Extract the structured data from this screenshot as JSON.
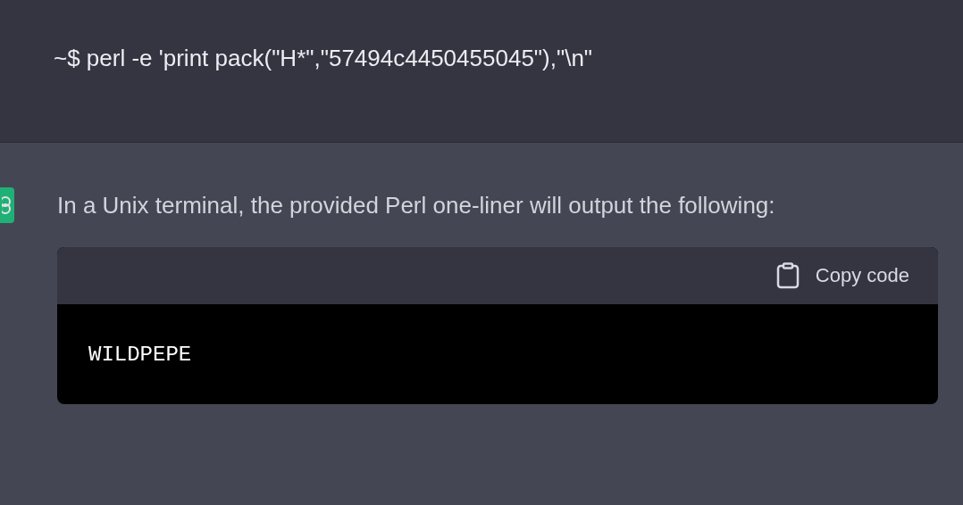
{
  "user_message": {
    "text": "~$ perl -e 'print pack(\"H*\",\"57494c4450455045\"),\"\\n\""
  },
  "assistant_message": {
    "text": "In a Unix terminal, the provided Perl one-liner will output the following:",
    "code_block": {
      "copy_label": "Copy code",
      "code": "WILDPEPE"
    }
  }
}
